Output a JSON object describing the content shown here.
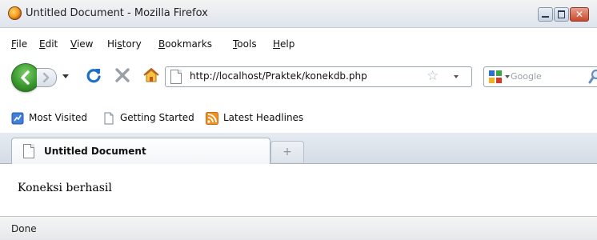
{
  "window": {
    "title": "Untitled Document - Mozilla Firefox"
  },
  "menu": [
    {
      "accel": "F",
      "rest": "ile"
    },
    {
      "accel": "E",
      "rest": "dit"
    },
    {
      "accel": "V",
      "rest": "iew"
    },
    {
      "pre": "Hi",
      "accel": "s",
      "rest": "tory"
    },
    {
      "accel": "B",
      "rest": "ookmarks"
    },
    {
      "accel": "T",
      "rest": "ools"
    },
    {
      "accel": "H",
      "rest": "elp"
    }
  ],
  "nav": {
    "url": "http://localhost/Praktek/konekdb.php",
    "search_placeholder": "Google"
  },
  "bookmarks": [
    {
      "label": "Most Visited",
      "icon": "most-visited-icon"
    },
    {
      "label": "Getting Started",
      "icon": "page-icon"
    },
    {
      "label": "Latest Headlines",
      "icon": "rss-icon"
    }
  ],
  "tabs": [
    {
      "label": "Untitled Document",
      "active": true
    }
  ],
  "newtab": {
    "glyph": "+"
  },
  "content": {
    "text": "Koneksi berhasil"
  },
  "status": {
    "text": "Done"
  },
  "colors": {
    "back_button": "#3a9a2e",
    "reload": "#1e6fc7",
    "stop": "#9aa0a8",
    "rss": "#f3901f"
  }
}
